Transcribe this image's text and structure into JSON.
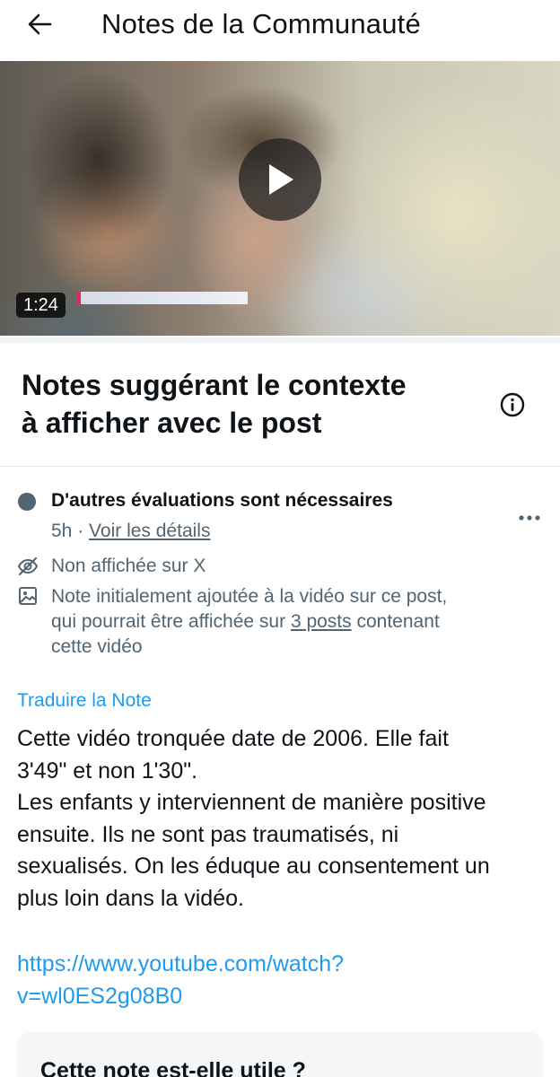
{
  "header": {
    "title": "Notes de la Communauté",
    "back_icon": "arrow-left-icon"
  },
  "video": {
    "duration": "1:24",
    "play_icon": "play-icon"
  },
  "section": {
    "title_line1": "Notes suggérant le contexte",
    "title_line2": "à afficher avec le post",
    "info_icon": "info-icon"
  },
  "note": {
    "status": "D'autres évaluations sont nécessaires",
    "status_color": "#536471",
    "age": "5h",
    "separator": "·",
    "details_link": "Voir les détails",
    "more_icon": "more-horizontal-icon",
    "visibility": "Non affichée sur X",
    "visibility_icon": "eye-off-icon",
    "media_icon": "image-icon",
    "media_line1": "Note initialement ajoutée à la vidéo sur ce post,",
    "media_line2_before": "qui pourrait être affichée sur ",
    "media_line2_link": "3 posts",
    "media_line2_after": " contenant",
    "media_line3": "cette vidéo",
    "translate": "Traduire la Note",
    "body_line1": "Cette vidéo tronquée date de 2006. Elle fait",
    "body_line2": "3'49\" et non 1'30\".",
    "body_line3": "Les enfants y interviennent de manière positive",
    "body_line4": "ensuite. Ils ne sont pas traumatisés, ni",
    "body_line5": "sexualisés. On les éduque au consentement un",
    "body_line6": "plus loin dans la vidéo.",
    "url_line1": "https://www.youtube.com/watch?",
    "url_line2": "v=wl0ES2g08B0",
    "link_color": "#1d9bf0"
  },
  "helpful": {
    "question": "Cette note est-elle utile ?"
  }
}
